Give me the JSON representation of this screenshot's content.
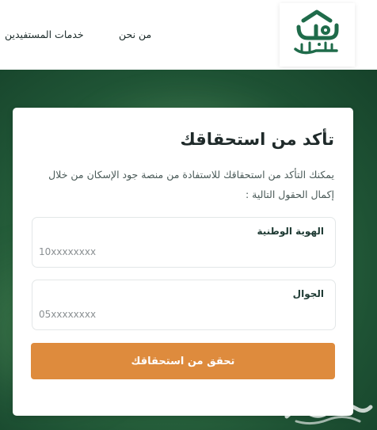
{
  "header": {
    "logo_text": "جود الإسكان",
    "nav": {
      "about": "من نحن",
      "services": "خدمات المستفيدين"
    }
  },
  "card": {
    "title": "تأكد من استحقاقك",
    "description": "يمكنك التأكد من استحقاقك للاستفادة من منصة جود الإسكان من خلال إكمال الحقول التالية :",
    "national_id": {
      "label": "الهوية الوطنية",
      "placeholder": "10xxxxxxxx"
    },
    "phone": {
      "label": "الجوال",
      "placeholder": "05xxxxxxxx"
    },
    "submit_label": "تحقق من استحقاقك"
  },
  "colors": {
    "brand_green": "#1f6b4a",
    "hero_green": "#2f6d42",
    "button_orange": "#de8b3d"
  }
}
